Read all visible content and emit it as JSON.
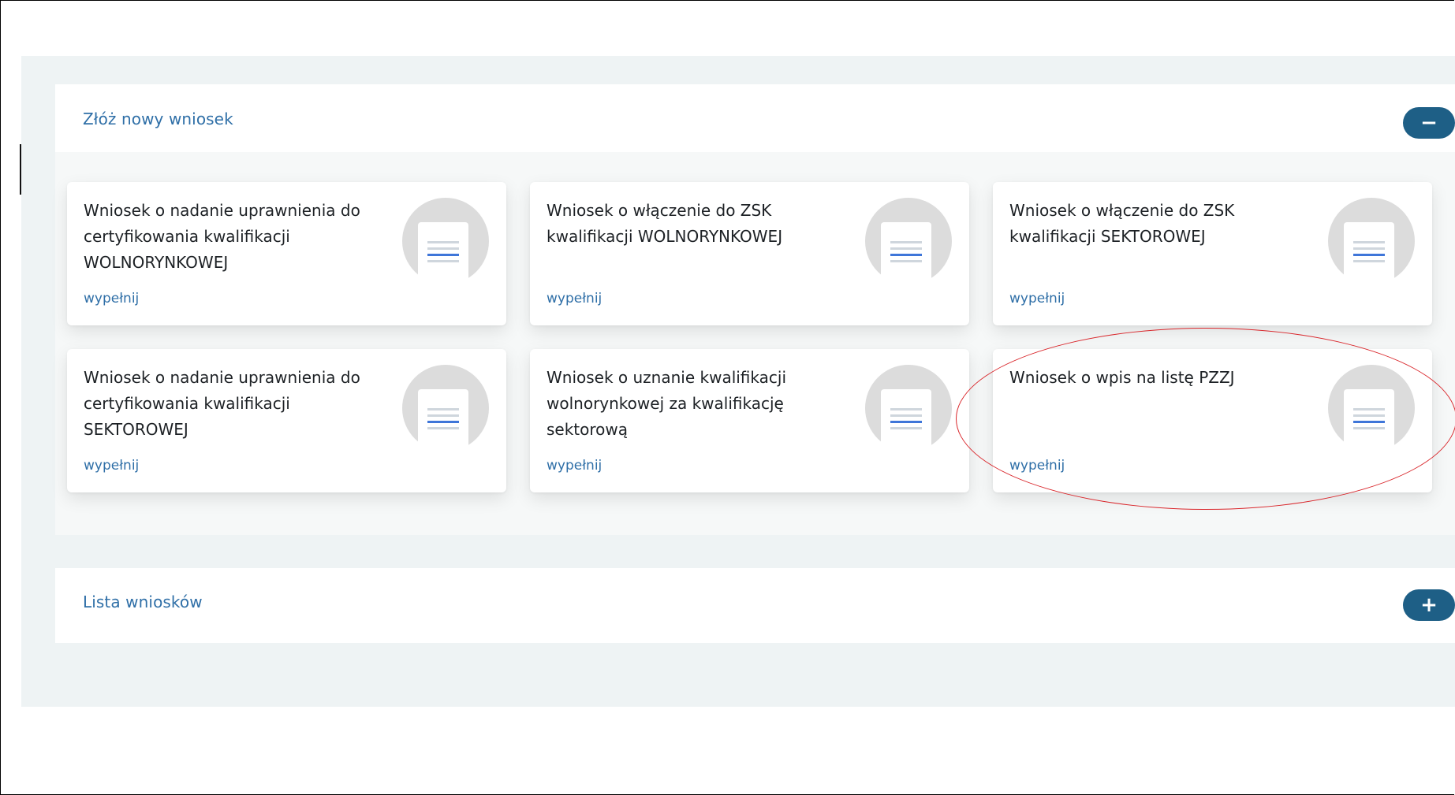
{
  "new_application_panel": {
    "title": "Złóż nowy wniosek",
    "toggle_symbol": "−",
    "cards": [
      {
        "title": "Wniosek o nadanie uprawnienia do certyfikowania kwalifikacji WOLNORYNKOWEJ",
        "link": "wypełnij",
        "icon": "document-icon"
      },
      {
        "title": "Wniosek o włączenie do ZSK kwalifikacji WOLNORYNKOWEJ",
        "link": "wypełnij",
        "icon": "document-icon"
      },
      {
        "title": "Wniosek o włączenie do ZSK kwalifikacji SEKTOROWEJ",
        "link": "wypełnij",
        "icon": "document-icon"
      },
      {
        "title": "Wniosek o nadanie uprawnienia do certyfikowania kwalifikacji SEKTOROWEJ",
        "link": "wypełnij",
        "icon": "document-icon"
      },
      {
        "title": "Wniosek o uznanie kwalifikacji wolnorynkowej za kwalifikację sektorową",
        "link": "wypełnij",
        "icon": "document-icon"
      },
      {
        "title": "Wniosek o wpis na listę PZZJ",
        "link": "wypełnij",
        "icon": "document-icon"
      }
    ]
  },
  "application_list_panel": {
    "title": "Lista wniosków",
    "toggle_symbol": "+"
  },
  "colors": {
    "accent_blue": "#2f6fa7",
    "button_bg": "#1e5f86",
    "annotation_red": "#d9262b",
    "background": "#eef3f4"
  }
}
